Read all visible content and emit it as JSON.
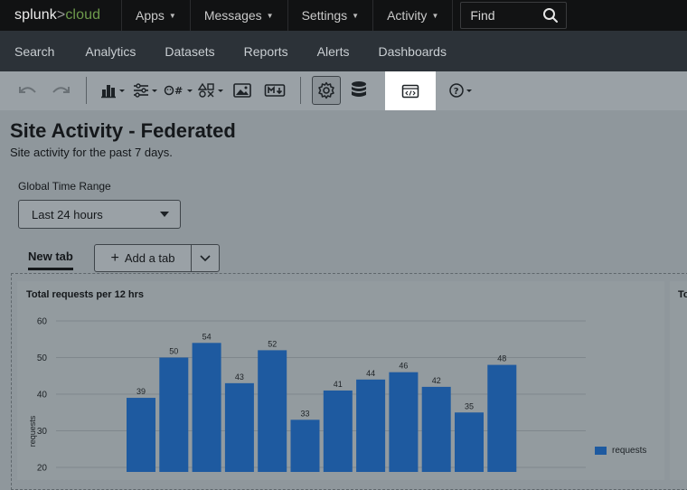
{
  "header": {
    "logo_main": "splunk",
    "logo_gt": ">",
    "logo_suffix": "cloud",
    "nav": [
      {
        "label": "Apps"
      },
      {
        "label": "Messages"
      },
      {
        "label": "Settings"
      },
      {
        "label": "Activity"
      }
    ],
    "find_placeholder": "Find"
  },
  "appbar": {
    "items": [
      "Search",
      "Analytics",
      "Datasets",
      "Reports",
      "Alerts",
      "Dashboards"
    ]
  },
  "toolbar": {
    "icons": [
      "undo-icon",
      "redo-icon",
      "add-chart-icon",
      "add-input-icon",
      "add-single-value-icon",
      "add-shape-icon",
      "add-image-icon",
      "add-markdown-icon",
      "settings-icon",
      "data-source-icon",
      "source-code-icon",
      "help-icon"
    ]
  },
  "dashboard": {
    "title": "Site Activity - Federated",
    "description": "Site activity for the past 7 days.",
    "time_range_label": "Global Time Range",
    "time_range_value": "Last 24 hours",
    "tab_label": "New tab",
    "add_tab_label": "Add a tab",
    "panel2_title": "To"
  },
  "chart_data": {
    "type": "bar",
    "title": "Total requests per 12 hrs",
    "ylabel": "requests",
    "ylim": [
      20,
      60
    ],
    "yticks": [
      20,
      30,
      40,
      50,
      60
    ],
    "values": [
      39,
      50,
      54,
      43,
      52,
      33,
      41,
      44,
      46,
      42,
      35,
      48
    ],
    "series": [
      {
        "name": "requests",
        "color": "#1e5aa0"
      }
    ]
  }
}
